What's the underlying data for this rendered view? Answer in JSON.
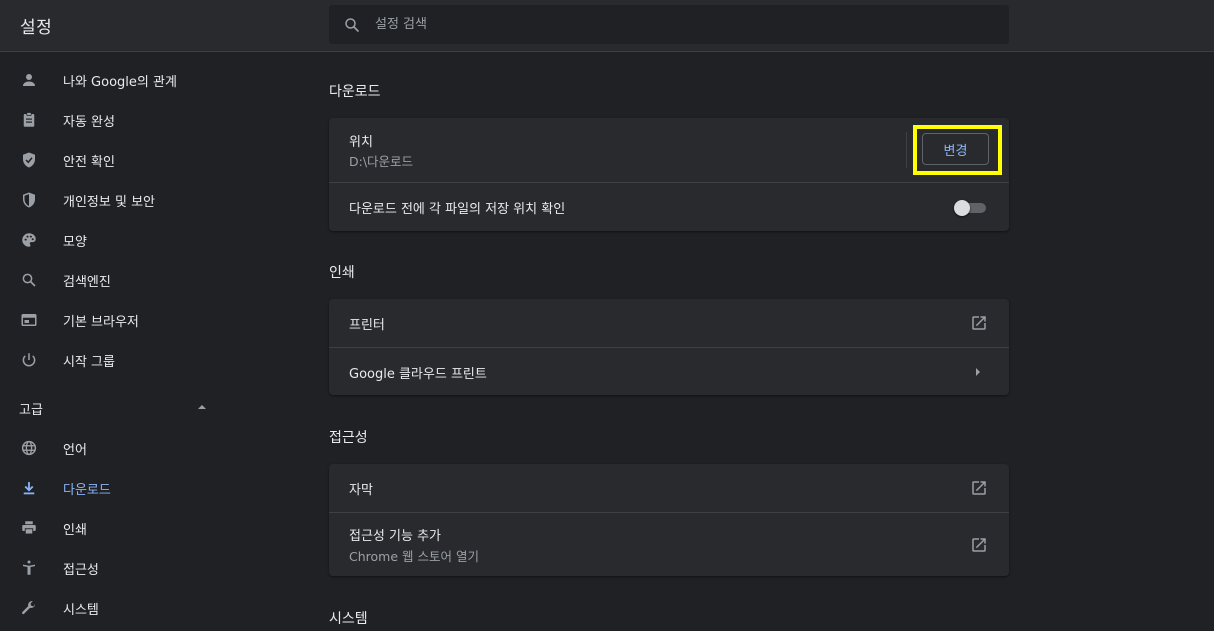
{
  "header": {
    "title": "설정",
    "search_placeholder": "설정 검색"
  },
  "sidebar": {
    "items": [
      {
        "label": "나와 Google의 관계",
        "icon": "person-icon"
      },
      {
        "label": "자동 완성",
        "icon": "clipboard-icon"
      },
      {
        "label": "안전 확인",
        "icon": "shield-check-icon"
      },
      {
        "label": "개인정보 및 보안",
        "icon": "shield-icon"
      },
      {
        "label": "모양",
        "icon": "palette-icon"
      },
      {
        "label": "검색엔진",
        "icon": "search-icon"
      },
      {
        "label": "기본 브라우저",
        "icon": "browser-window-icon"
      },
      {
        "label": "시작 그룹",
        "icon": "power-icon"
      }
    ],
    "advanced_label": "고급",
    "advanced_items": [
      {
        "label": "언어",
        "icon": "globe-icon"
      },
      {
        "label": "다운로드",
        "icon": "download-icon",
        "active": true
      },
      {
        "label": "인쇄",
        "icon": "printer-icon"
      },
      {
        "label": "접근성",
        "icon": "accessibility-icon"
      },
      {
        "label": "시스템",
        "icon": "wrench-icon"
      }
    ]
  },
  "main": {
    "downloads": {
      "title": "다운로드",
      "location_label": "위치",
      "location_value": "D:\\다운로드",
      "change_button": "변경",
      "ask_label": "다운로드 전에 각 파일의 저장 위치 확인",
      "ask_enabled": false
    },
    "printing": {
      "title": "인쇄",
      "printers_label": "프린터",
      "cloud_print_label": "Google 클라우드 프린트"
    },
    "accessibility": {
      "title": "접근성",
      "captions_label": "자막",
      "add_features_label": "접근성 기능 추가",
      "add_features_sub": "Chrome 웹 스토어 열기"
    },
    "system": {
      "title": "시스템"
    }
  },
  "colors": {
    "background": "#202124",
    "surface": "#292a2d",
    "accent": "#8ab4f8",
    "highlight": "#ffff00"
  }
}
